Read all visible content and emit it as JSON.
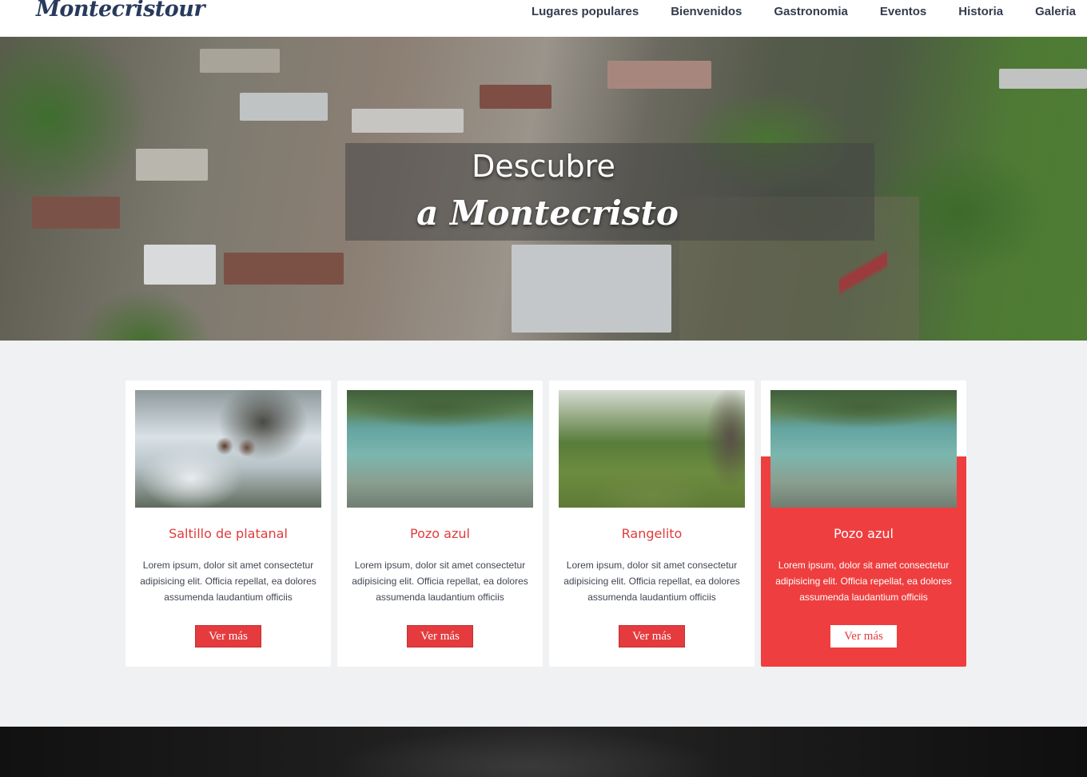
{
  "header": {
    "logo": "Montecristour",
    "nav": [
      "Lugares populares",
      "Bienvenidos",
      "Gastronomia",
      "Eventos",
      "Historia",
      "Galeria"
    ]
  },
  "hero": {
    "line1": "Descubre",
    "line2": "a Montecristo"
  },
  "cards": [
    {
      "title": "Saltillo de platanal",
      "text": "Lorem ipsum, dolor sit amet consectetur adipisicing elit. Officia repellat, ea dolores assumenda laudantium officiis",
      "button": "Ver más"
    },
    {
      "title": "Pozo azul",
      "text": "Lorem ipsum, dolor sit amet consectetur adipisicing elit. Officia repellat, ea dolores assumenda laudantium officiis",
      "button": "Ver más"
    },
    {
      "title": "Rangelito",
      "text": "Lorem ipsum, dolor sit amet consectetur adipisicing elit. Officia repellat, ea dolores assumenda laudantium officiis",
      "button": "Ver más"
    },
    {
      "title": "Pozo azul",
      "text": "Lorem ipsum, dolor sit amet consectetur adipisicing elit. Officia repellat, ea dolores assumenda laudantium officiis",
      "button": "Ver más"
    }
  ],
  "colors": {
    "accent": "#ef3e3f",
    "logo": "#283a5c",
    "page_bg": "#f0f1f3"
  }
}
